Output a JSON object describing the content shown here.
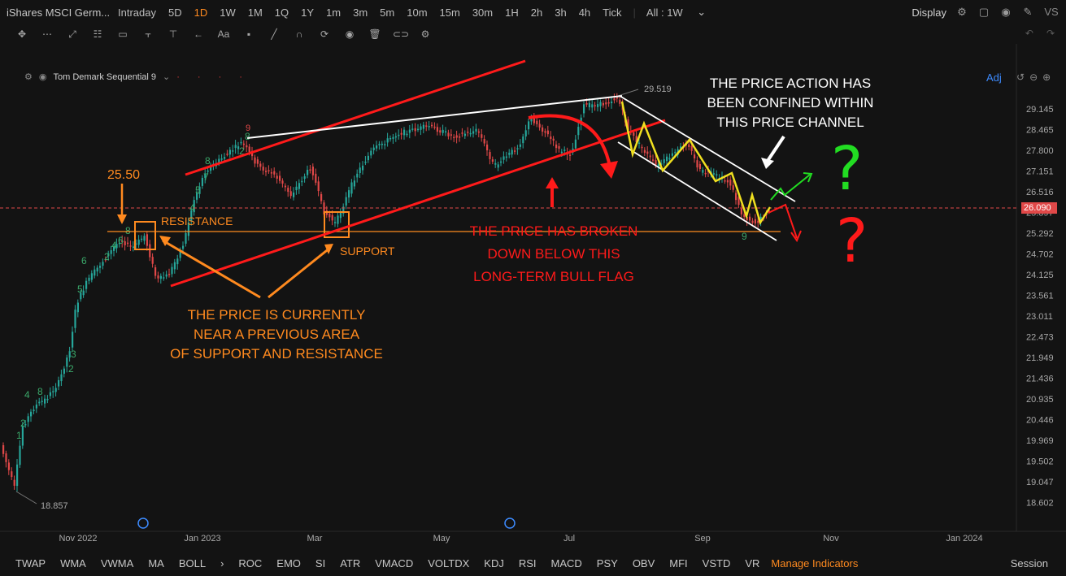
{
  "header": {
    "symbol": "iShares MSCI Germ...",
    "timeframes": [
      "Intraday",
      "5D",
      "1D",
      "1W",
      "1M",
      "1Q",
      "1Y",
      "1m",
      "3m",
      "5m",
      "10m",
      "15m",
      "30m",
      "1H",
      "2h",
      "3h",
      "4h",
      "Tick"
    ],
    "active_timeframe": "1D",
    "range_selector": "All : 1W",
    "display_label": "Display",
    "vs_label": "VS"
  },
  "indicator": {
    "name": "Tom Demark Sequential 9",
    "adj_label": "Adj"
  },
  "price_axis": {
    "ticks": [
      "29.145",
      "28.465",
      "27.800",
      "27.151",
      "26.516",
      "25.897",
      "25.292",
      "24.702",
      "24.125",
      "23.561",
      "23.011",
      "22.473",
      "21.949",
      "21.436",
      "20.935",
      "20.446",
      "19.969",
      "19.502",
      "19.047",
      "18.602"
    ],
    "current_price": "26.090",
    "high_label": "29.519",
    "low_label": "18.857"
  },
  "time_axis": {
    "ticks": [
      "Nov 2022",
      "Jan 2023",
      "Mar",
      "May",
      "Jul",
      "Sep",
      "Nov",
      "Jan 2024"
    ]
  },
  "annotations": {
    "level_label": "25.50",
    "resistance": "RESISTANCE",
    "support": "SUPPORT",
    "note_bottom_lines": [
      "THE PRICE IS CURRENTLY",
      "NEAR A PREVIOUS AREA",
      "OF SUPPORT AND RESISTANCE"
    ],
    "note_broken_lines": [
      "THE PRICE HAS BROKEN",
      "DOWN BELOW THIS",
      "LONG-TERM BULL FLAG"
    ],
    "note_channel_lines": [
      "THE PRICE ACTION HAS",
      "BEEN CONFINED WITHIN",
      "THIS PRICE CHANNEL"
    ],
    "question_mark": "?",
    "td_count": "9"
  },
  "bottom": {
    "indicators": [
      "TWAP",
      "WMA",
      "VWMA",
      "MA",
      "BOLL",
      "ROC",
      "EMO",
      "SI",
      "ATR",
      "VMACD",
      "VOLTDX",
      "KDJ",
      "RSI",
      "MACD",
      "PSY",
      "OBV",
      "MFI",
      "VSTD",
      "VR"
    ],
    "more_label": "›",
    "manage_label": "Manage Indicators",
    "session_label": "Session"
  },
  "colors": {
    "background": "#131313",
    "accent": "#ff8a1f",
    "up_candle": "#26a69a",
    "down_candle": "#e04848",
    "trend_red": "#ff1a1a",
    "channel_white": "#ffffff",
    "zigzag_yellow": "#f0e020",
    "arrow_green": "#22dd22",
    "price_line": "#e04848",
    "adj_blue": "#3d8bff"
  }
}
